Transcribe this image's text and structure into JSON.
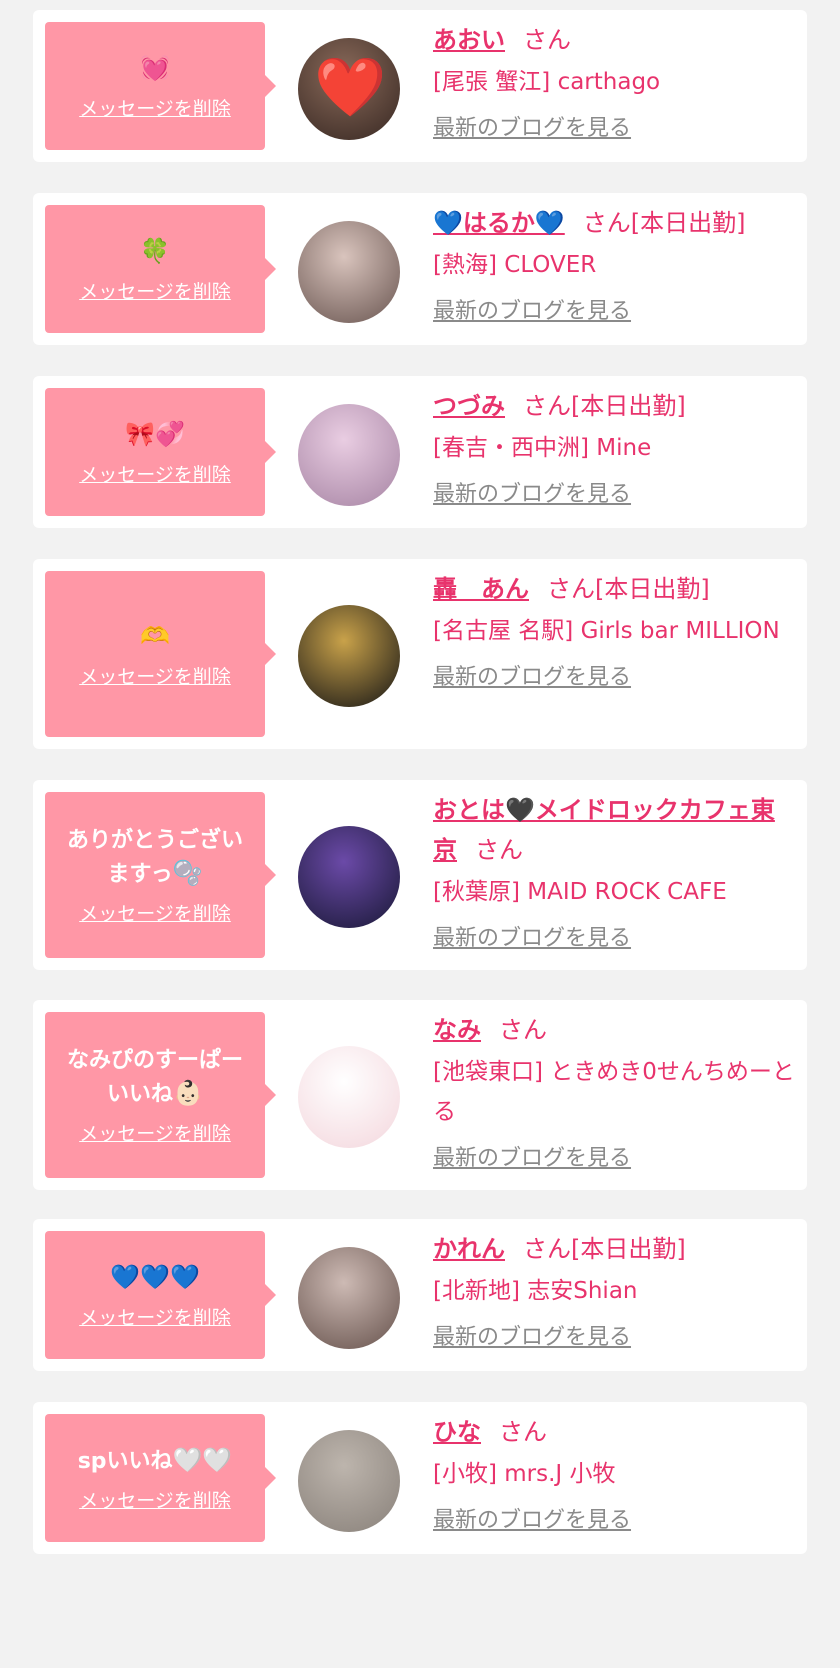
{
  "cards": [
    {
      "message": "",
      "message_emoji": "💓",
      "delete_label": "メッセージを削除",
      "name": "あおい",
      "suffix": "さん",
      "shop": "[尾張 蟹江] carthago",
      "blog_label": "最新のブログを見る",
      "avatar_colors": [
        "#8a6a5a",
        "#3a2a24"
      ],
      "avatar_overlay": "❤️"
    },
    {
      "message": "",
      "message_emoji": "🍀",
      "delete_label": "メッセージを削除",
      "name": "💙はるか💙",
      "suffix": "さん[本日出勤]",
      "shop": "[熱海] CLOVER",
      "blog_label": "最新のブログを見る",
      "avatar_colors": [
        "#d9c4bd",
        "#6e5a55"
      ]
    },
    {
      "message": "",
      "message_emoji": "🎀💞",
      "delete_label": "メッセージを削除",
      "name": "つづみ",
      "suffix": "さん[本日出勤]",
      "shop": "[春吉・西中洲] Mine",
      "blog_label": "最新のブログを見る",
      "avatar_colors": [
        "#e9cde2",
        "#a987a6"
      ]
    },
    {
      "message": "",
      "message_emoji": "🫶",
      "delete_label": "メッセージを削除",
      "name": "轟　あん",
      "suffix": "さん[本日出勤]",
      "shop": "[名古屋 名駅] Girls bar MILLION",
      "blog_label": "最新のブログを見る",
      "avatar_colors": [
        "#c9a24a",
        "#1c1a17"
      ]
    },
    {
      "message": "ありがとうございますっ",
      "message_emoji": "🫧",
      "delete_label": "メッセージを削除",
      "name": "おとは🖤メイドロックカフェ東京",
      "suffix": "さん",
      "shop": "[秋葉原] MAID ROCK CAFE",
      "blog_label": "最新のブログを見る",
      "avatar_colors": [
        "#6b4aa8",
        "#1c1a3a"
      ]
    },
    {
      "message": "なみぴのすーぱーいいね",
      "message_emoji": "👶🏻",
      "delete_label": "メッセージを削除",
      "name": "なみ",
      "suffix": "さん",
      "shop": "[池袋東口] ときめき0せんちめーとる",
      "blog_label": "最新のブログを見る",
      "avatar_colors": [
        "#ffffff",
        "#f4d8de"
      ]
    },
    {
      "message": "",
      "message_emoji": "💙💙💙",
      "delete_label": "メッセージを削除",
      "name": "かれん",
      "suffix": "さん[本日出勤]",
      "shop": "[北新地] 志安Shian",
      "blog_label": "最新のブログを見る",
      "avatar_colors": [
        "#cdbab4",
        "#6a5650"
      ]
    },
    {
      "message": "spいいね",
      "message_emoji": "🤍🤍",
      "delete_label": "メッセージを削除",
      "name": "ひな",
      "suffix": "さん",
      "shop": "[小牧] mrs.J 小牧",
      "blog_label": "最新のブログを見る",
      "avatar_colors": [
        "#bdb5ad",
        "#8b837c"
      ]
    }
  ]
}
